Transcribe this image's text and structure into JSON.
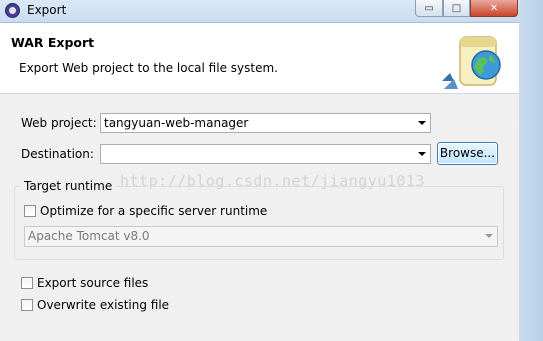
{
  "window": {
    "title": "Export",
    "minimize_glyph": "▭",
    "maximize_glyph": "□",
    "close_glyph": "✕"
  },
  "header": {
    "title": "WAR Export",
    "description": "Export Web project to the local file system."
  },
  "form": {
    "web_project_label": "Web project:",
    "web_project_value": "tangyuan-web-manager",
    "destination_label": "Destination:",
    "destination_value": "",
    "browse_label": "Browse..."
  },
  "target_runtime": {
    "group_label": "Target runtime",
    "optimize_label": "Optimize for a specific server runtime",
    "optimize_checked": false,
    "runtime_value": "Apache Tomcat v8.0",
    "runtime_enabled": false
  },
  "options": {
    "export_source_label": "Export source files",
    "export_source_checked": false,
    "overwrite_label": "Overwrite existing file",
    "overwrite_checked": false
  },
  "watermark": "http://blog.csdn.net/jiangyu1013"
}
